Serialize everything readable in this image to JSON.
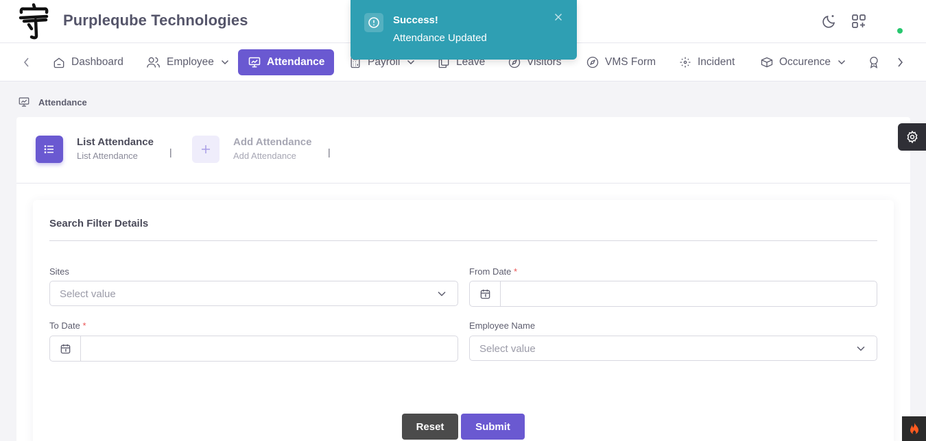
{
  "header": {
    "brand": "Purpleqube Technologies",
    "icons": [
      "logo-mark",
      "moon-icon",
      "apps-add-icon"
    ]
  },
  "toast": {
    "title": "Success!",
    "message": "Attendance Updated",
    "color": "#2f9fb3"
  },
  "nav": {
    "items": [
      {
        "label": "Dashboard",
        "icon": "home-icon"
      },
      {
        "label": "Employee",
        "icon": "users-icon",
        "dropdown": true
      },
      {
        "label": "Attendance",
        "icon": "monitor-chart-icon",
        "active": true
      },
      {
        "label": "Payroll",
        "icon": "calculator-icon",
        "dropdown": true
      },
      {
        "label": "Leave",
        "icon": "copy-icon"
      },
      {
        "label": "Visitors",
        "icon": "compass-icon"
      },
      {
        "label": "VMS Form",
        "icon": "compass-icon"
      },
      {
        "label": "Incident",
        "icon": "focus-icon"
      },
      {
        "label": "Occurence",
        "icon": "box-icon",
        "dropdown": true
      }
    ],
    "accent": "#6a59d1"
  },
  "breadcrumb": {
    "label": "Attendance"
  },
  "tabs": [
    {
      "title": "List Attendance",
      "subtitle": "List Attendance",
      "active": true
    },
    {
      "title": "Add Attendance",
      "subtitle": "Add Attendance",
      "active": false
    }
  ],
  "tab_separator": "|",
  "filter": {
    "title": "Search Filter Details",
    "sites_label": "Sites",
    "sites_placeholder": "Select value",
    "from_date_label": "From Date",
    "to_date_label": "To Date",
    "employee_label": "Employee Name",
    "employee_placeholder": "Select value",
    "required_mark": "*"
  },
  "buttons": {
    "reset": "Reset",
    "submit": "Submit"
  }
}
